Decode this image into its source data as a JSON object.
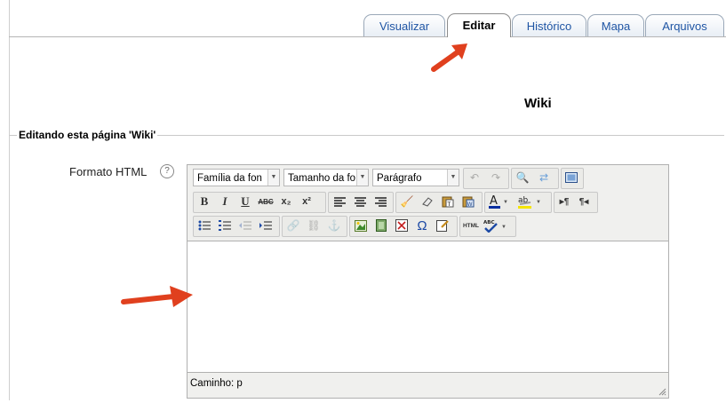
{
  "tabs": [
    {
      "label": "Visualizar"
    },
    {
      "label": "Editar"
    },
    {
      "label": "Histórico"
    },
    {
      "label": "Mapa"
    },
    {
      "label": "Arquivos"
    }
  ],
  "page": {
    "title": "Wiki"
  },
  "form": {
    "legend": "Editando esta página 'Wiki'",
    "format_label": "Formato HTML",
    "help_glyph": "?"
  },
  "editor": {
    "font_family": "Família da fon",
    "font_size": "Tamanho da fo",
    "block_format": "Parágrafo",
    "buttons": {
      "bold": "B",
      "italic": "I",
      "underline": "U",
      "strike": "ABC",
      "sub": "x₂",
      "sup": "x²",
      "html": "HTML",
      "spell": "ABC",
      "ltr": "▸¶",
      "rtl": "¶◂",
      "omega": "Ω"
    },
    "path_label": "Caminho: p",
    "icons": [
      "undo-icon",
      "redo-icon",
      "find-icon",
      "replace-icon",
      "fullscreen-icon",
      "clean-icon",
      "eraser-icon",
      "paste-text-icon",
      "paste-word-icon",
      "font-color-icon",
      "highlight-icon",
      "bullet-list-icon",
      "numbered-list-icon",
      "outdent-icon",
      "indent-icon",
      "link-icon",
      "unlink-icon",
      "anchor-icon",
      "image-icon",
      "media-icon",
      "nolink-icon",
      "special-char-icon",
      "edit-icon"
    ]
  },
  "colors": {
    "accent": "#1f55a4",
    "arrow": "#e0401e"
  }
}
